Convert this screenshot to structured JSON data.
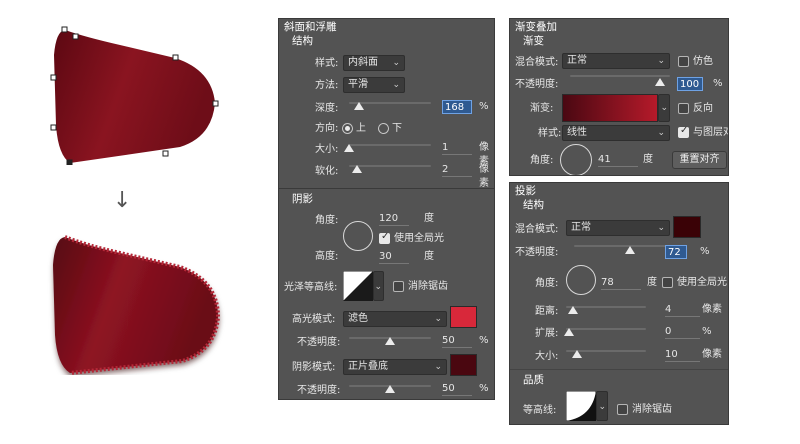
{
  "arrow": "↓",
  "bevel": {
    "title": "斜面和浮雕",
    "structure": "结构",
    "style_label": "样式:",
    "style_value": "内斜面",
    "technique_label": "方法:",
    "technique_value": "平滑",
    "depth_label": "深度:",
    "depth_value": "168",
    "depth_unit": "%",
    "direction_label": "方向:",
    "direction_up": "上",
    "direction_down": "下",
    "size_label": "大小:",
    "size_value": "1",
    "size_unit": "像素",
    "soften_label": "软化:",
    "soften_value": "2",
    "soften_unit": "像素",
    "shading": "阴影",
    "angle_label": "角度:",
    "angle_value": "120",
    "angle_unit": "度",
    "global_light": "使用全局光",
    "altitude_label": "高度:",
    "altitude_value": "30",
    "altitude_unit": "度",
    "gloss_label": "光泽等高线:",
    "antialias": "消除锯齿",
    "highlight_label": "高光模式:",
    "highlight_value": "滤色",
    "highlight_color": "#d8283a",
    "opacity_label": "不透明度:",
    "highlight_opacity": "50",
    "shadow_label": "阴影模式:",
    "shadow_value": "正片叠底",
    "shadow_color": "#4a0710",
    "shadow_opacity": "50",
    "pct": "%"
  },
  "gradient": {
    "title": "渐变叠加",
    "section": "渐变",
    "blend_label": "混合模式:",
    "blend_value": "正常",
    "dither": "仿色",
    "opacity_label": "不透明度:",
    "opacity_value": "100",
    "opacity_unit": "%",
    "gradient_label": "渐变:",
    "reverse": "反向",
    "style_label": "样式:",
    "style_value": "线性",
    "align_layer": "与图层对",
    "angle_label": "角度:",
    "angle_value": "41",
    "angle_unit": "度",
    "reset_button": "重置对齐"
  },
  "drop_shadow": {
    "title": "投影",
    "structure": "结构",
    "blend_label": "混合模式:",
    "blend_value": "正常",
    "color": "#3a0206",
    "opacity_label": "不透明度:",
    "opacity_value": "72",
    "opacity_unit": "%",
    "angle_label": "角度:",
    "angle_value": "78",
    "angle_unit": "度",
    "global_light": "使用全局光",
    "distance_label": "距离:",
    "distance_value": "4",
    "distance_unit": "像素",
    "spread_label": "扩展:",
    "spread_value": "0",
    "spread_unit": "%",
    "size_label": "大小:",
    "size_value": "10",
    "size_unit": "像素",
    "quality": "品质",
    "contour_label": "等高线:",
    "antialias": "消除锯齿"
  }
}
